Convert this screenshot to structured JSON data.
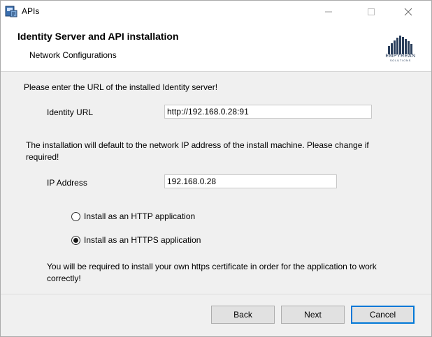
{
  "window": {
    "title": "APIs"
  },
  "header": {
    "title": "Identity Server and API installation",
    "subtitle": "Network Configurations",
    "logo_text": "EMPYREAN",
    "logo_subtext": "SOLUTIONS"
  },
  "identity": {
    "prompt": "Please enter the URL of the installed Identity server!",
    "label": "Identity URL",
    "value": "http://192.168.0.28:91"
  },
  "ip": {
    "prompt": "The installation will default to the network IP address of the install machine. Please change if required!",
    "label": "IP Address",
    "value": "192.168.0.28"
  },
  "install_mode": {
    "options": [
      {
        "label": "Install as an HTTP application",
        "checked": false
      },
      {
        "label": "Install as an HTTPS application",
        "checked": true
      }
    ],
    "note": "You will be required to install your own https certificate in order for the application to work correctly!"
  },
  "buttons": {
    "back": "Back",
    "next": "Next",
    "cancel": "Cancel"
  }
}
